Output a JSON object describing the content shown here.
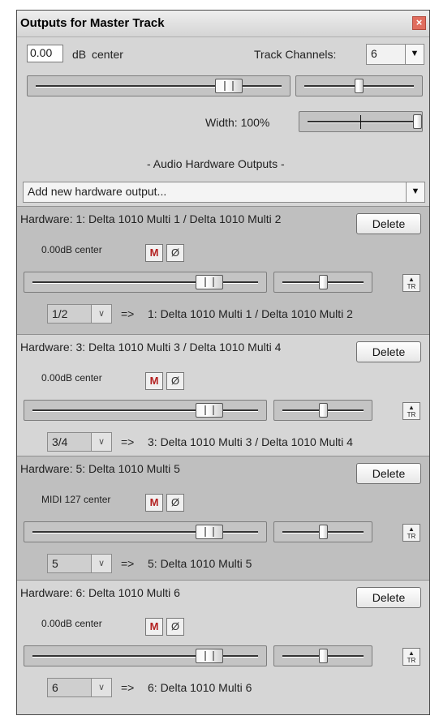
{
  "window": {
    "title": "Outputs for Master Track",
    "close_glyph": "×"
  },
  "master": {
    "db_value": "0.00",
    "db_label": "dB",
    "pan_label": "center",
    "track_channels_label": "Track Channels:",
    "track_channels_value": "6",
    "width_label": "Width: 100%",
    "volume_level": 0.8,
    "pan_level": 0.5,
    "width_level": 1.0
  },
  "audio_hw_label": "- Audio Hardware Outputs -",
  "add_output": {
    "value": "Add new hardware output..."
  },
  "outputs": [
    {
      "title": "Hardware: 1: Delta 1010 Multi 1 / Delta 1010 Multi 2",
      "delete_label": "Delete",
      "level_text": "0.00dB center",
      "mute_label": "M",
      "phase_label": "Ø",
      "tr_label": "TR",
      "channel": "1/2",
      "arrow": "=>",
      "destination": "1: Delta 1010 Multi 1 / Delta 1010 Multi 2",
      "volume_level": 0.8,
      "pan_level": 0.5
    },
    {
      "title": "Hardware: 3: Delta 1010 Multi 3 / Delta 1010 Multi 4",
      "delete_label": "Delete",
      "level_text": "0.00dB center",
      "mute_label": "M",
      "phase_label": "Ø",
      "tr_label": "TR",
      "channel": "3/4",
      "arrow": "=>",
      "destination": "3: Delta 1010 Multi 3 / Delta 1010 Multi 4",
      "volume_level": 0.8,
      "pan_level": 0.5
    },
    {
      "title": "Hardware: 5: Delta 1010 Multi 5",
      "delete_label": "Delete",
      "level_text": "MIDI 127 center",
      "mute_label": "M",
      "phase_label": "Ø",
      "tr_label": "TR",
      "channel": "5",
      "arrow": "=>",
      "destination": "5: Delta 1010 Multi 5",
      "volume_level": 0.8,
      "pan_level": 0.5
    },
    {
      "title": "Hardware: 6: Delta 1010 Multi 6",
      "delete_label": "Delete",
      "level_text": "0.00dB center",
      "mute_label": "M",
      "phase_label": "Ø",
      "tr_label": "TR",
      "channel": "6",
      "arrow": "=>",
      "destination": "6: Delta 1010 Multi 6",
      "volume_level": 0.8,
      "pan_level": 0.5
    }
  ]
}
